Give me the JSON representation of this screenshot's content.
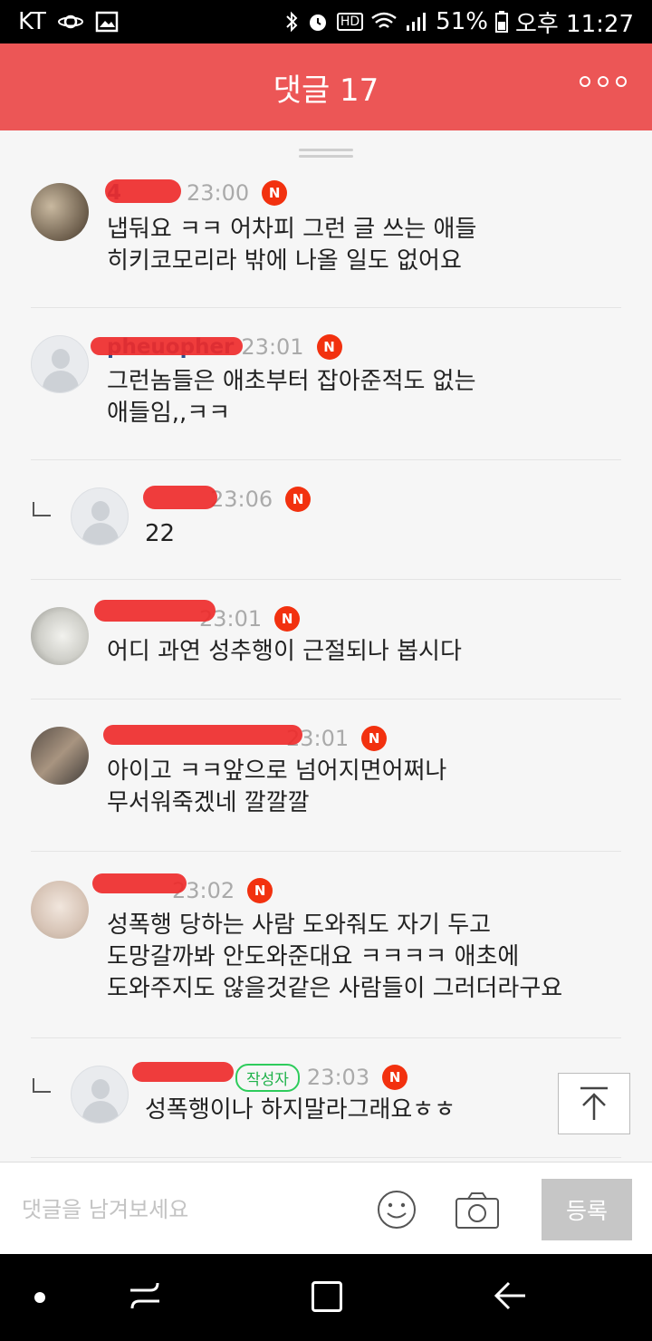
{
  "status_bar": {
    "carrier": "KT",
    "hd_label": "HD",
    "battery": "51%",
    "time": "오후 11:27"
  },
  "header": {
    "title": "댓글 17"
  },
  "comments": [
    {
      "name": "4",
      "time": "23:00",
      "new": "N",
      "text_lines": [
        "냅둬요 ㅋㅋ 어차피 그런 글 쓰는 애들",
        "히키코모리라 밖에 나올 일도 없어요"
      ]
    },
    {
      "name": "pheuopher",
      "time": "23:01",
      "new": "N",
      "text_lines": [
        "그런놈들은 애초부터 잡아준적도 없는",
        "애들임,,ㅋㅋ"
      ]
    },
    {
      "name": "",
      "time": "23:06",
      "new": "N",
      "text_lines": [
        "22"
      ]
    },
    {
      "name": "",
      "time": "23:01",
      "new": "N",
      "text_lines": [
        "어디 과연 성추행이 근절되나 봅시다"
      ]
    },
    {
      "name": "",
      "time": "23:01",
      "new": "N",
      "text_lines": [
        "아이고 ㅋㅋ앞으로 넘어지면어쩌나",
        "무서워죽겠네 깔깔깔"
      ]
    },
    {
      "name": "",
      "time": "23:02",
      "new": "N",
      "text_lines": [
        "성폭행 당하는 사람 도와줘도 자기 두고",
        "도망갈까봐 안도와준대요 ㅋㅋㅋㅋ 애초에",
        "도와주지도 않을것같은 사람들이 그러더라구요"
      ]
    },
    {
      "name": "",
      "author_badge": "작성자",
      "time": "23:03",
      "new": "N",
      "text_lines": [
        "성폭행이나 하지말라그래요ㅎㅎ"
      ]
    }
  ],
  "input_bar": {
    "placeholder": "댓글을 남겨보세요",
    "submit_label": "등록"
  },
  "icons": {
    "emoji": "smile-icon",
    "camera": "camera-icon",
    "scroll_top": "arrow-up-to-top-icon",
    "more": "more-dots-icon"
  },
  "colors": {
    "header": "#ec5656",
    "new_badge": "#f2310f",
    "author_badge": "#2ecc5c",
    "submit_disabled": "#c6c6c6"
  }
}
